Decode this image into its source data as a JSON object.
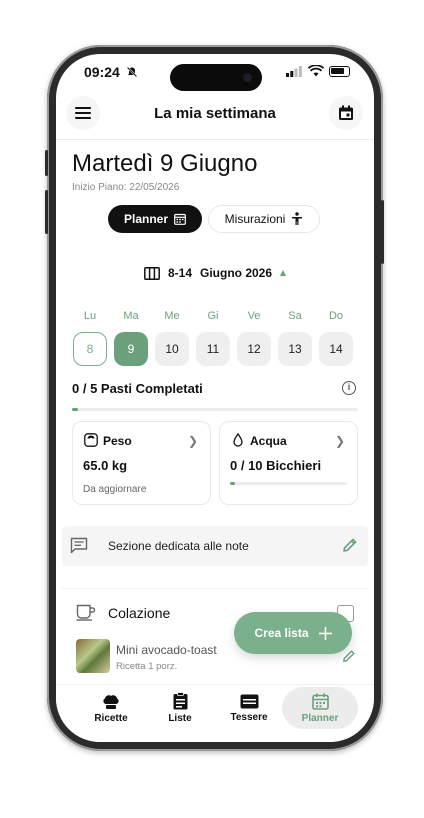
{
  "status": {
    "time": "09:24"
  },
  "header": {
    "title": "La mia settimana"
  },
  "day": {
    "title": "Martedì 9 Giugno",
    "plan_start": "Inizio Piano: 22/05/2026"
  },
  "segments": {
    "planner": "Planner",
    "measurements": "Misurazioni"
  },
  "week": {
    "range_label": "8-14",
    "month_label": "Giugno 2026",
    "days": [
      {
        "dow": "Lu",
        "num": "8",
        "state": "outline"
      },
      {
        "dow": "Ma",
        "num": "9",
        "state": "selected"
      },
      {
        "dow": "Me",
        "num": "10",
        "state": "normal"
      },
      {
        "dow": "Gi",
        "num": "11",
        "state": "normal"
      },
      {
        "dow": "Ve",
        "num": "12",
        "state": "normal"
      },
      {
        "dow": "Sa",
        "num": "13",
        "state": "normal"
      },
      {
        "dow": "Do",
        "num": "14",
        "state": "normal"
      }
    ]
  },
  "meals_progress": {
    "label": "0 / 5 Pasti Completati",
    "fraction": 0.02
  },
  "weight_card": {
    "title": "Peso",
    "value": "65.0 kg",
    "sub": "Da aggiornare"
  },
  "water_card": {
    "title": "Acqua",
    "value": "0 / 10 Bicchieri",
    "fraction": 0.03
  },
  "notes": {
    "label": "Sezione dedicata alle note"
  },
  "meal": {
    "title": "Colazione",
    "item_name": "Mini avocado-toast",
    "item_sub": "Ricetta 1 porz."
  },
  "fab": {
    "label": "Crea lista"
  },
  "tabs": [
    {
      "label": "Ricette",
      "icon": "chef-hat-icon"
    },
    {
      "label": "Liste",
      "icon": "clipboard-icon"
    },
    {
      "label": "Tessere",
      "icon": "card-icon"
    },
    {
      "label": "Planner",
      "icon": "calendar-icon"
    }
  ],
  "colors": {
    "accent": "#6aa07c",
    "fab": "#7ab08b",
    "dark": "#111111"
  }
}
